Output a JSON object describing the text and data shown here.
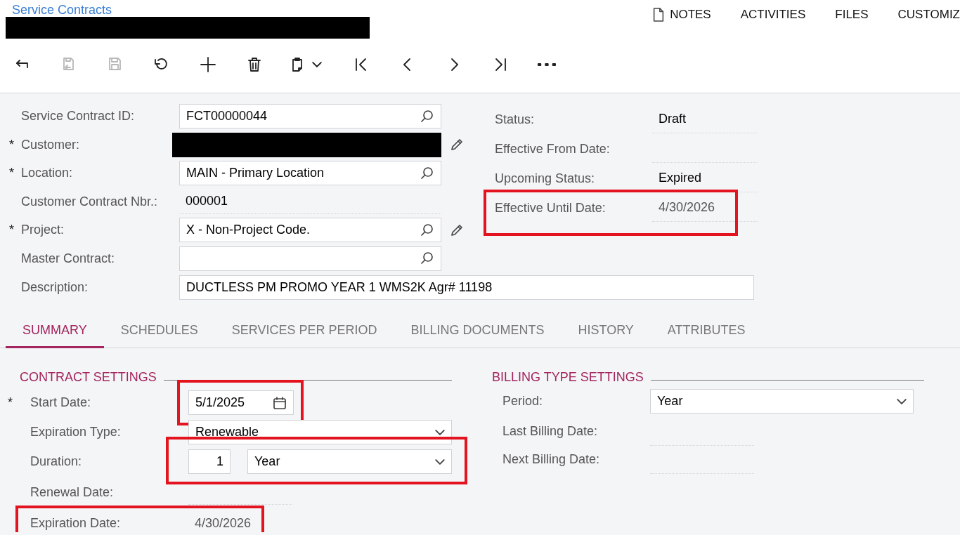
{
  "breadcrumb": "Service Contracts",
  "title": {
    "redacted": true
  },
  "header_links": [
    {
      "label": "NOTES",
      "kind": "icon-link"
    },
    {
      "label": "ACTIVITIES",
      "kind": "link"
    },
    {
      "label": "FILES",
      "kind": "link"
    },
    {
      "label": "CUSTOMIZ",
      "kind": "link"
    }
  ],
  "toolbar": [
    {
      "kind": "back",
      "disabled": false
    },
    {
      "kind": "save-close",
      "disabled": true
    },
    {
      "kind": "save",
      "disabled": true
    },
    {
      "kind": "undo",
      "disabled": false
    },
    {
      "kind": "add",
      "disabled": false
    },
    {
      "kind": "delete",
      "disabled": false
    },
    {
      "kind": "clipboard",
      "disabled": false
    },
    {
      "kind": "first",
      "disabled": false
    },
    {
      "kind": "prev",
      "disabled": false
    },
    {
      "kind": "next",
      "disabled": false
    },
    {
      "kind": "last",
      "disabled": false
    },
    {
      "kind": "more",
      "disabled": false
    }
  ],
  "form_left": [
    {
      "label": "Service Contract ID:",
      "kind": "lookup",
      "value": "FCT00000044",
      "editable": false
    },
    {
      "label": "Customer:",
      "required_mark": "*",
      "kind": "redacted",
      "editable": true
    },
    {
      "label": "Location:",
      "required_mark": "*",
      "kind": "lookup",
      "value": "MAIN - Primary Location",
      "editable": false
    },
    {
      "label": "Customer Contract Nbr.:",
      "kind": "plain",
      "value": "000001",
      "editable": false
    },
    {
      "label": "Project:",
      "required_mark": "*",
      "kind": "lookup",
      "value": "X - Non-Project Code.",
      "editable": true
    },
    {
      "label": "Master Contract:",
      "kind": "lookup",
      "editable": false
    }
  ],
  "description": {
    "label": "Description:",
    "value": "DUCTLESS PM PROMO YEAR 1 WMS2K Agr# 11198"
  },
  "form_right": [
    {
      "label": "Status:",
      "value": "Draft",
      "disabled": false,
      "highlighted": false
    },
    {
      "label": "Effective From Date:",
      "highlighted": false
    },
    {
      "label": "Upcoming Status:",
      "value": "Expired",
      "disabled": false,
      "highlighted": false
    },
    {
      "label": "Effective Until Date:",
      "value": "4/30/2026",
      "disabled": true,
      "highlighted": true
    }
  ],
  "tabs": [
    {
      "label": "SUMMARY",
      "selected": true
    },
    {
      "label": "SCHEDULES",
      "selected": false
    },
    {
      "label": "SERVICES PER PERIOD",
      "selected": false
    },
    {
      "label": "BILLING DOCUMENTS",
      "selected": false
    },
    {
      "label": "HISTORY",
      "selected": false
    },
    {
      "label": "ATTRIBUTES",
      "selected": false
    }
  ],
  "contract_settings": {
    "title": "CONTRACT SETTINGS",
    "fields": [
      {
        "label": "Start Date:",
        "required_mark": "*",
        "kind": "date",
        "value": "5/1/2025",
        "highlighted": true
      },
      {
        "label": "Expiration Type:",
        "kind": "select",
        "value": "Renewable",
        "highlighted": false
      },
      {
        "label": "Duration:",
        "kind": "duration",
        "value": "1",
        "unit": "Year",
        "highlighted": true
      },
      {
        "label": "Renewal Date:",
        "kind": "plain",
        "highlighted": false
      },
      {
        "label": "Expiration Date:",
        "kind": "plain",
        "value": "4/30/2026",
        "highlighted": true
      }
    ]
  },
  "billing_settings": {
    "title": "BILLING TYPE SETTINGS",
    "fields": [
      {
        "label": "Period:",
        "kind": "select",
        "value": "Year"
      },
      {
        "label": "Last Billing Date:",
        "kind": "plain"
      },
      {
        "label": "Next Billing Date:",
        "kind": "plain"
      }
    ]
  }
}
